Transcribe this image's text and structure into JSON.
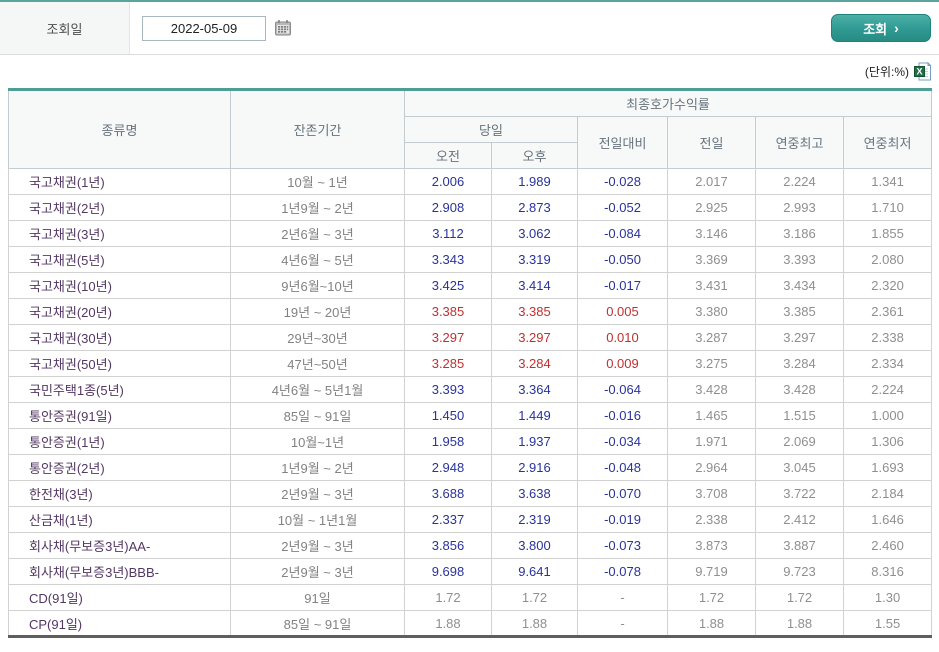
{
  "query_bar": {
    "label": "조회일",
    "date_value": "2022-05-09",
    "search_button_label": "조회",
    "search_button_chevron": "›"
  },
  "unit_label": "(단위:%)",
  "colors": {
    "accent_teal": "#35a099",
    "value_down_blue": "#29339b",
    "value_up_red": "#c03030",
    "value_flat_gray": "#8f8f8f",
    "name_purple": "#533763"
  },
  "icons": {
    "calendar": "calendar-icon",
    "excel": "excel-export-icon"
  },
  "table": {
    "headers": {
      "col_name": "종류명",
      "col_period": "잔존기간",
      "group_yield": "최종호가수익률",
      "group_today": "당일",
      "am": "오전",
      "pm": "오후",
      "change": "전일대비",
      "prev": "전일",
      "year_high": "연중최고",
      "year_low": "연중최저"
    },
    "rows": [
      {
        "name": "국고채권(1년)",
        "period": "10월 ~ 1년",
        "am": "2.006",
        "pm": "1.989",
        "change": "-0.028",
        "prev": "2.017",
        "year_high": "2.224",
        "year_low": "1.341",
        "trend": "down"
      },
      {
        "name": "국고채권(2년)",
        "period": "1년9월 ~ 2년",
        "am": "2.908",
        "pm": "2.873",
        "change": "-0.052",
        "prev": "2.925",
        "year_high": "2.993",
        "year_low": "1.710",
        "trend": "down"
      },
      {
        "name": "국고채권(3년)",
        "period": "2년6월 ~ 3년",
        "am": "3.112",
        "pm": "3.062",
        "change": "-0.084",
        "prev": "3.146",
        "year_high": "3.186",
        "year_low": "1.855",
        "trend": "down"
      },
      {
        "name": "국고채권(5년)",
        "period": "4년6월 ~ 5년",
        "am": "3.343",
        "pm": "3.319",
        "change": "-0.050",
        "prev": "3.369",
        "year_high": "3.393",
        "year_low": "2.080",
        "trend": "down"
      },
      {
        "name": "국고채권(10년)",
        "period": "9년6월~10년",
        "am": "3.425",
        "pm": "3.414",
        "change": "-0.017",
        "prev": "3.431",
        "year_high": "3.434",
        "year_low": "2.320",
        "trend": "down"
      },
      {
        "name": "국고채권(20년)",
        "period": "19년 ~ 20년",
        "am": "3.385",
        "pm": "3.385",
        "change": "0.005",
        "prev": "3.380",
        "year_high": "3.385",
        "year_low": "2.361",
        "trend": "up"
      },
      {
        "name": "국고채권(30년)",
        "period": "29년~30년",
        "am": "3.297",
        "pm": "3.297",
        "change": "0.010",
        "prev": "3.287",
        "year_high": "3.297",
        "year_low": "2.338",
        "trend": "up"
      },
      {
        "name": "국고채권(50년)",
        "period": "47년~50년",
        "am": "3.285",
        "pm": "3.284",
        "change": "0.009",
        "prev": "3.275",
        "year_high": "3.284",
        "year_low": "2.334",
        "trend": "up"
      },
      {
        "name": "국민주택1종(5년)",
        "period": "4년6월 ~ 5년1월",
        "am": "3.393",
        "pm": "3.364",
        "change": "-0.064",
        "prev": "3.428",
        "year_high": "3.428",
        "year_low": "2.224",
        "trend": "down"
      },
      {
        "name": "통안증권(91일)",
        "period": "85일 ~ 91일",
        "am": "1.450",
        "pm": "1.449",
        "change": "-0.016",
        "prev": "1.465",
        "year_high": "1.515",
        "year_low": "1.000",
        "trend": "down"
      },
      {
        "name": "통안증권(1년)",
        "period": "10월~1년",
        "am": "1.958",
        "pm": "1.937",
        "change": "-0.034",
        "prev": "1.971",
        "year_high": "2.069",
        "year_low": "1.306",
        "trend": "down"
      },
      {
        "name": "통안증권(2년)",
        "period": "1년9월 ~ 2년",
        "am": "2.948",
        "pm": "2.916",
        "change": "-0.048",
        "prev": "2.964",
        "year_high": "3.045",
        "year_low": "1.693",
        "trend": "down"
      },
      {
        "name": "한전채(3년)",
        "period": "2년9월 ~ 3년",
        "am": "3.688",
        "pm": "3.638",
        "change": "-0.070",
        "prev": "3.708",
        "year_high": "3.722",
        "year_low": "2.184",
        "trend": "down"
      },
      {
        "name": "산금채(1년)",
        "period": "10월 ~ 1년1월",
        "am": "2.337",
        "pm": "2.319",
        "change": "-0.019",
        "prev": "2.338",
        "year_high": "2.412",
        "year_low": "1.646",
        "trend": "down"
      },
      {
        "name": "회사채(무보증3년)AA-",
        "period": "2년9월 ~ 3년",
        "am": "3.856",
        "pm": "3.800",
        "change": "-0.073",
        "prev": "3.873",
        "year_high": "3.887",
        "year_low": "2.460",
        "trend": "down"
      },
      {
        "name": "회사채(무보증3년)BBB-",
        "period": "2년9월 ~ 3년",
        "am": "9.698",
        "pm": "9.641",
        "change": "-0.078",
        "prev": "9.719",
        "year_high": "9.723",
        "year_low": "8.316",
        "trend": "down"
      },
      {
        "name": "CD(91일)",
        "period": "91일",
        "am": "1.72",
        "pm": "1.72",
        "change": "-",
        "prev": "1.72",
        "year_high": "1.72",
        "year_low": "1.30",
        "trend": "flat"
      },
      {
        "name": "CP(91일)",
        "period": "85일 ~ 91일",
        "am": "1.88",
        "pm": "1.88",
        "change": "-",
        "prev": "1.88",
        "year_high": "1.88",
        "year_low": "1.55",
        "trend": "flat"
      }
    ]
  }
}
